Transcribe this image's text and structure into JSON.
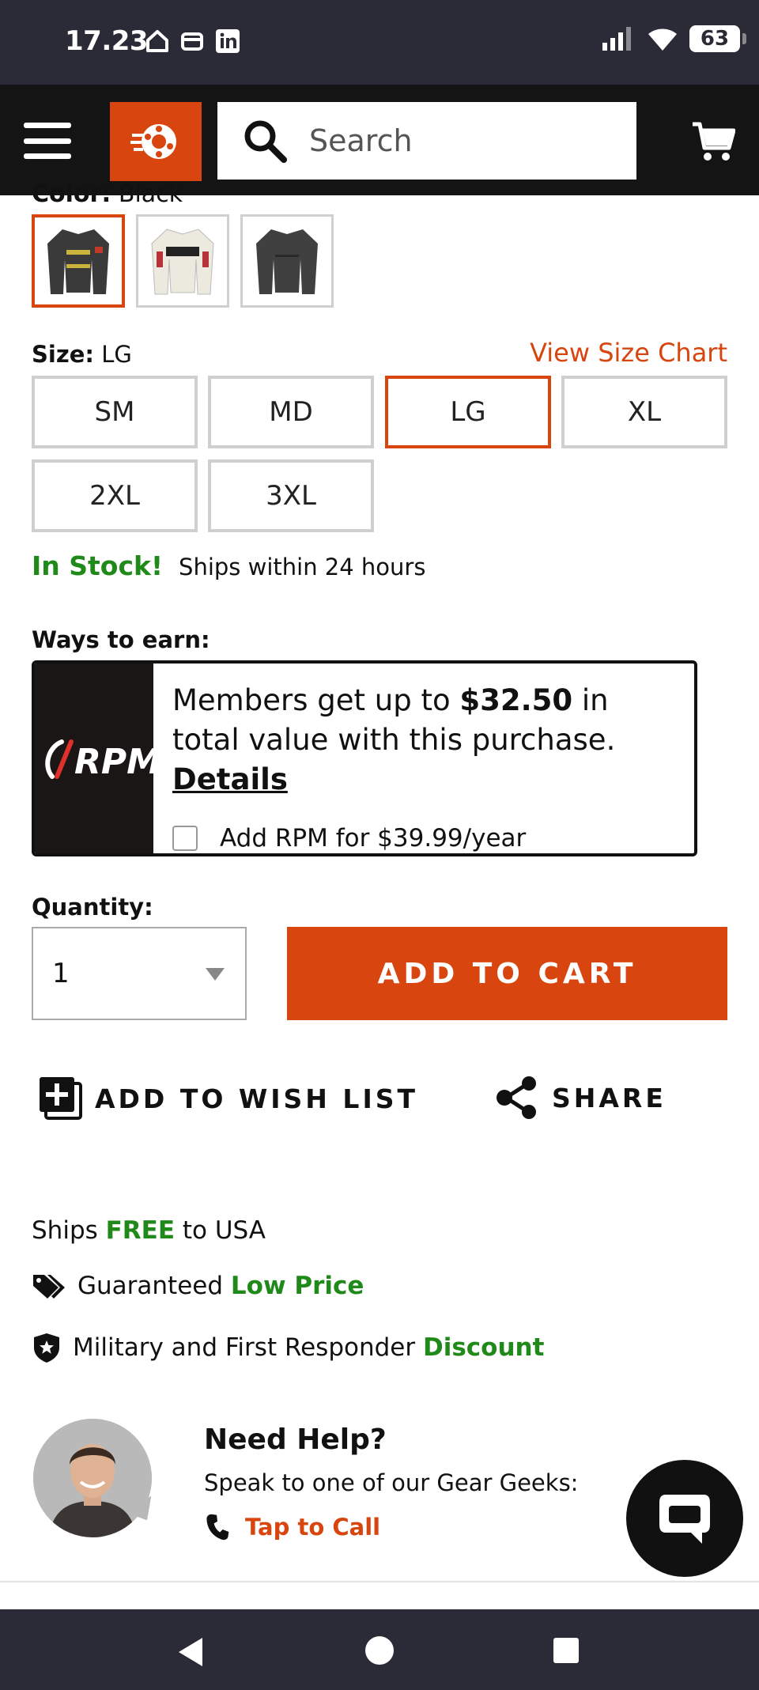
{
  "status_bar": {
    "time": "17.23",
    "battery": "63"
  },
  "header": {
    "search_placeholder": "Search"
  },
  "product": {
    "color_label": "Color:",
    "color_value": "Black",
    "size_label": "Size:",
    "size_value": "LG",
    "size_chart_link": "View Size Chart",
    "sizes": [
      "SM",
      "MD",
      "LG",
      "XL",
      "2XL",
      "3XL"
    ],
    "selected_size": "LG",
    "stock_status": "In Stock!",
    "ships_within": "Ships within 24 hours"
  },
  "rpm": {
    "ways_label": "Ways to earn:",
    "logo_text": "RPM",
    "text_before": "Members get up to ",
    "amount": "$32.50",
    "text_after": " in total value with this purchase. ",
    "details_link": "Details",
    "addon_label": "Add RPM for $39.99/year"
  },
  "purchase": {
    "quantity_label": "Quantity:",
    "quantity_value": "1",
    "add_to_cart": "ADD TO CART",
    "wish_list": "ADD TO WISH LIST",
    "share": "SHARE"
  },
  "perks": {
    "ships_prefix": "Ships ",
    "ships_highlight": "FREE",
    "ships_suffix": " to USA",
    "price_prefix": "Guaranteed ",
    "price_highlight": "Low Price",
    "military_prefix": "Military and First Responder ",
    "military_highlight": "Discount"
  },
  "help": {
    "title": "Need Help?",
    "subtitle": "Speak to one of our Gear Geeks:",
    "call_link": "Tap to Call"
  },
  "colors": {
    "accent": "#d9450f",
    "green": "#1f8a1a",
    "header_bg": "#151414",
    "system_bar": "#2b2b38"
  }
}
